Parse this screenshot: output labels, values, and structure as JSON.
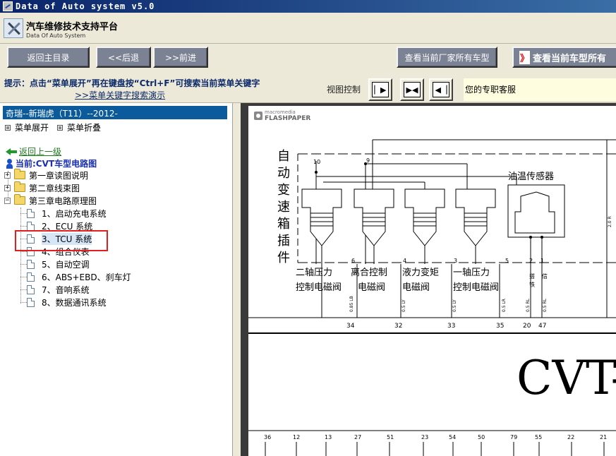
{
  "window": {
    "title": "Data of Auto system v5.0"
  },
  "brand": {
    "title": "汽车维修技术支持平台",
    "subtitle": "Data Of Auto System"
  },
  "toolbar": {
    "home": "返回主目录",
    "back": "<<后退",
    "forward": ">>前进",
    "maker_models": "查看当前厂家所有车型",
    "current_models_arrows": "》",
    "current_models": "查看当前车型所有"
  },
  "hint": {
    "text": "提示：点击“菜单展开”再在键盘按“Ctrl+F”可搜索当前菜单关键字",
    "link": ">>菜单关键字搜索演示",
    "view_label": "视图控制",
    "service": "您的专职客服"
  },
  "nav": {
    "crumb": "奇瑞--新瑞虎（T11）--2012-",
    "expand": "菜单展开",
    "collapse": "菜单折叠",
    "back": "返回上一级",
    "current": "当前:CVT车型电路图",
    "chapters": [
      "第一章读图说明",
      "第二章线束图",
      "第三章电路原理图"
    ],
    "items": [
      "1、启动充电系统",
      "2、ECU 系统",
      "3、TCU 系统",
      "4、组合仪表",
      "5、自动空调",
      "6、ABS+EBD、刹车灯",
      "7、音响系统",
      "8、数据通讯系统"
    ]
  },
  "viewer": {
    "brand_top": "macromedia",
    "brand_bottom": "FLASHPAPER",
    "connector_label": "自动变速箱插件",
    "sensor_label": "油温传感器",
    "big_title": "CVT-",
    "valves": [
      {
        "line1": "二轴压力",
        "line2": "控制电磁阀"
      },
      {
        "line1": "离合控制",
        "line2": "电磁阀"
      },
      {
        "line1": "液力变矩",
        "line2": "电磁阀"
      },
      {
        "line1": "一轴压力",
        "line2": "控制电磁阀"
      }
    ],
    "pin_top": [
      "10",
      "9",
      "6",
      "4",
      "3",
      "5",
      "2",
      "1"
    ],
    "wire_codes": [
      "0.85 LB",
      "0.5 LY",
      "0.5 LY",
      "0.5 LR",
      "0.5 RL",
      "0.5 RL",
      "2.0 R"
    ],
    "pins_mid": [
      "34",
      "32",
      "33",
      "35",
      "20",
      "47"
    ],
    "pins_bottom": [
      "36",
      "12",
      "13",
      "27",
      "51",
      "23",
      "54",
      "50",
      "79",
      "55",
      "22",
      "21"
    ],
    "sensor_marks": [
      "搭",
      "铁",
      "信"
    ]
  }
}
